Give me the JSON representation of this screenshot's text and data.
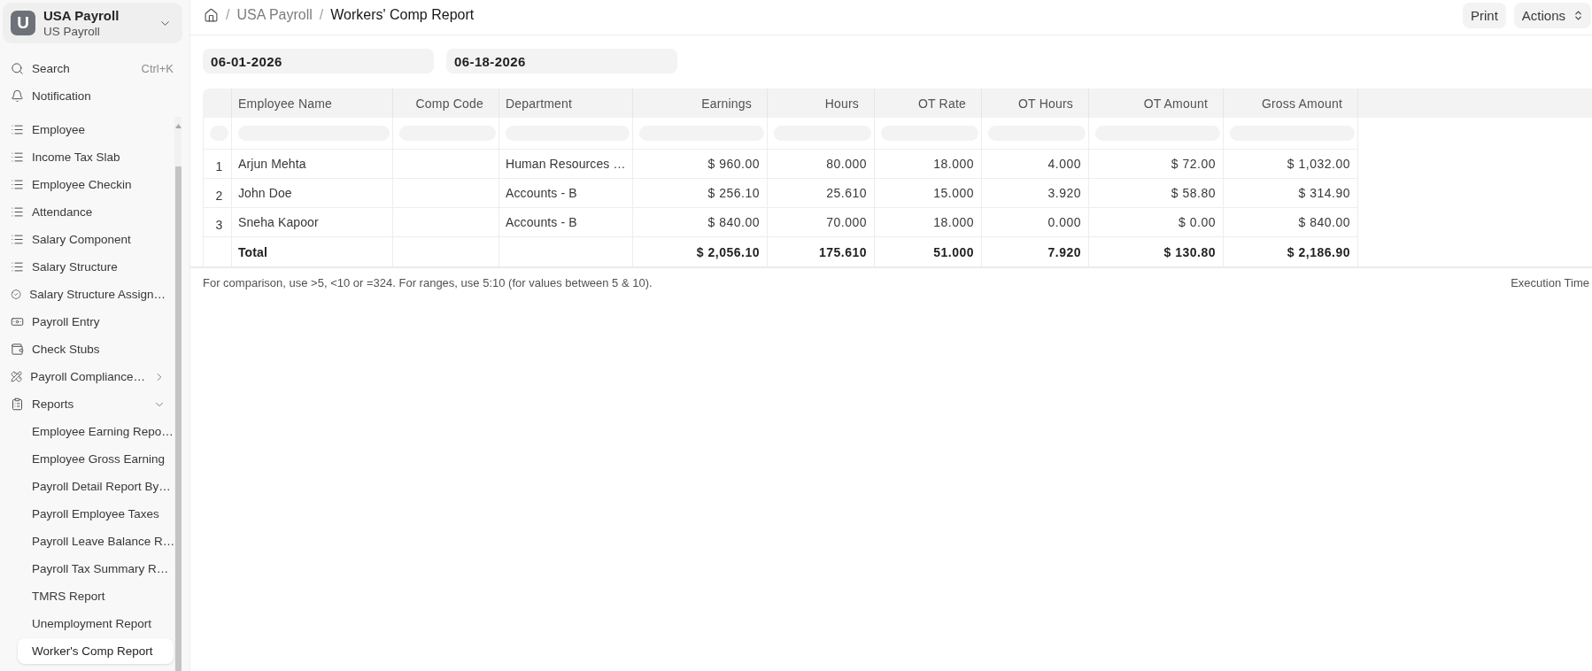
{
  "workspace": {
    "avatar": "U",
    "title": "USA Payroll",
    "subtitle": "US Payroll"
  },
  "sidebar": {
    "search": {
      "label": "Search",
      "shortcut": "Ctrl+K"
    },
    "notification": {
      "label": "Notification"
    },
    "items": [
      {
        "label": "Employee",
        "kind": "list",
        "selected": false
      },
      {
        "label": "Income Tax Slab",
        "kind": "list",
        "selected": false
      },
      {
        "label": "Employee Checkin",
        "kind": "list",
        "selected": false
      },
      {
        "label": "Attendance",
        "kind": "list",
        "selected": false
      },
      {
        "label": "Salary Component",
        "kind": "list",
        "selected": false
      },
      {
        "label": "Salary Structure",
        "kind": "list",
        "selected": false
      },
      {
        "label": "Salary Structure Assign…",
        "kind": "link",
        "selected": false
      },
      {
        "label": "Payroll Entry",
        "kind": "link",
        "selected": false
      },
      {
        "label": "Check Stubs",
        "kind": "link",
        "selected": false
      },
      {
        "label": "Payroll Compliance…",
        "kind": "group",
        "selected": false,
        "expanded": false
      },
      {
        "label": "Reports",
        "kind": "group",
        "selected": false,
        "expanded": true,
        "children": [
          {
            "label": "Employee Earning Repo…",
            "selected": false
          },
          {
            "label": "Employee Gross Earning",
            "selected": false
          },
          {
            "label": "Payroll Detail Report By…",
            "selected": false
          },
          {
            "label": "Payroll Employee Taxes",
            "selected": false
          },
          {
            "label": "Payroll Leave Balance R…",
            "selected": false
          },
          {
            "label": "Payroll Tax Summary R…",
            "selected": false
          },
          {
            "label": "TMRS Report",
            "selected": false
          },
          {
            "label": "Unemployment Report",
            "selected": false
          },
          {
            "label": "Worker's Comp Report",
            "selected": true
          }
        ]
      }
    ]
  },
  "breadcrumb": {
    "items": [
      {
        "separator": "/",
        "label": "USA Payroll",
        "current": false
      },
      {
        "separator": "/",
        "label": "Workers' Comp Report",
        "current": true
      }
    ]
  },
  "toolbar": {
    "buttons": [
      {
        "label": "Print",
        "kind": "button"
      },
      {
        "label": "Actions",
        "kind": "menu"
      }
    ]
  },
  "filters": [
    {
      "value": "06-01-2026"
    },
    {
      "value": "06-18-2026"
    }
  ],
  "table": {
    "columns": [
      {
        "label": "Employee Name",
        "kind": "text"
      },
      {
        "label": "Comp Code",
        "kind": "number"
      },
      {
        "label": "Department",
        "kind": "text"
      },
      {
        "label": "Earnings",
        "kind": "number"
      },
      {
        "label": "Hours",
        "kind": "number"
      },
      {
        "label": "OT Rate",
        "kind": "number"
      },
      {
        "label": "OT Hours",
        "kind": "number"
      },
      {
        "label": "OT Amount",
        "kind": "number"
      },
      {
        "label": "Gross Amount",
        "kind": "number"
      }
    ],
    "rows": [
      {
        "number": "1",
        "cells": [
          "Arjun Mehta",
          null,
          "Human Resources …",
          "$ 960.00",
          "80.000",
          "18.000",
          "4.000",
          "$ 72.00",
          "$ 1,032.00"
        ]
      },
      {
        "number": "2",
        "cells": [
          "John Doe",
          null,
          "Accounts - B",
          "$ 256.10",
          "25.610",
          "15.000",
          "3.920",
          "$ 58.80",
          "$ 314.90"
        ]
      },
      {
        "number": "3",
        "cells": [
          "Sneha Kapoor",
          null,
          "Accounts - B",
          "$ 840.00",
          "70.000",
          "18.000",
          "0.000",
          "$ 0.00",
          "$ 840.00"
        ]
      }
    ],
    "total": {
      "cells": [
        "Total",
        null,
        null,
        "$ 2,056.10",
        "175.610",
        "51.000",
        "7.920",
        "$ 130.80",
        "$ 2,186.90"
      ]
    }
  },
  "footer": {
    "hint": "For comparison, use >5, <10 or =324. For ranges, use 5:10 (for values between 5 & 10).",
    "execution_time": "Execution Time"
  }
}
